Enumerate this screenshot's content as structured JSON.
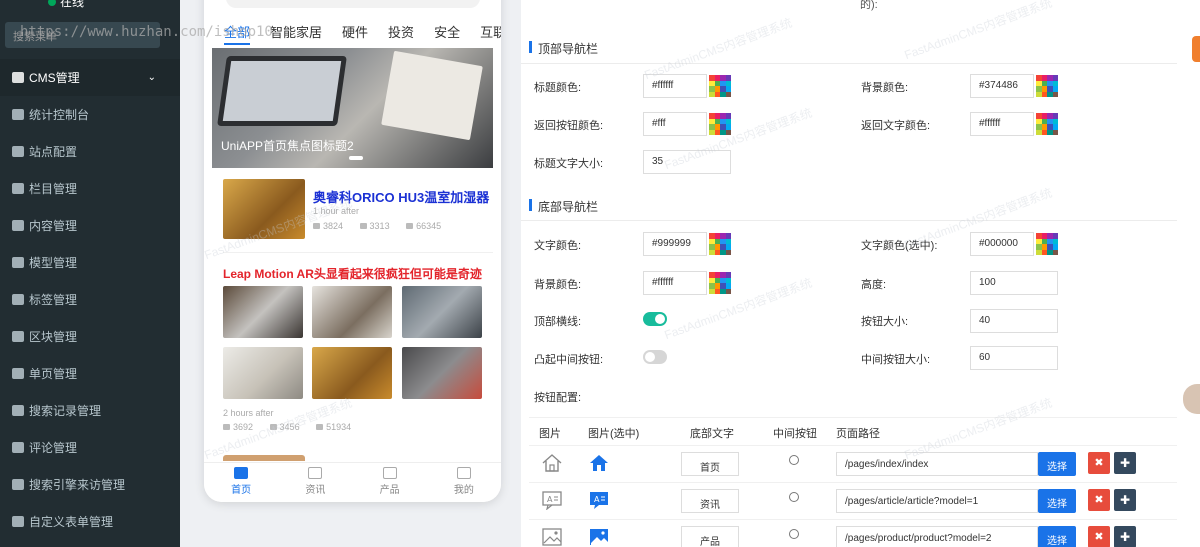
{
  "sidebar": {
    "status": "在线",
    "search_placeholder": "搜索菜单",
    "items": [
      {
        "label": "CMS管理",
        "icon": "file-icon",
        "active": true,
        "caret": "⌄"
      },
      {
        "label": "统计控制台",
        "icon": "bar-chart-icon"
      },
      {
        "label": "站点配置",
        "icon": "cogs-icon"
      },
      {
        "label": "栏目管理",
        "icon": "list-icon"
      },
      {
        "label": "内容管理",
        "icon": "file-text-icon"
      },
      {
        "label": "模型管理",
        "icon": "th-icon"
      },
      {
        "label": "标签管理",
        "icon": "tags-icon"
      },
      {
        "label": "区块管理",
        "icon": "th-large-icon"
      },
      {
        "label": "单页管理",
        "icon": "file-o-icon"
      },
      {
        "label": "搜索记录管理",
        "icon": "history-icon"
      },
      {
        "label": "评论管理",
        "icon": "comment-icon"
      },
      {
        "label": "搜索引擎来访管理",
        "icon": "search-icon"
      },
      {
        "label": "自定义表单管理",
        "icon": "table-icon"
      }
    ]
  },
  "watermark_url": "https://www.huzhan.com/ishop10",
  "watermark_text": "FastAdminCMS内容管理系统",
  "phone": {
    "tabs": [
      "全部",
      "智能家居",
      "硬件",
      "投资",
      "安全",
      "互联"
    ],
    "banner_caption": "UniAPP首页焦点图标题2",
    "article1": {
      "title": "奥睿科ORICO HU3温室加湿器",
      "time": "1 hour after",
      "likes": "3824",
      "comments": "3313",
      "views": "66345"
    },
    "article2": {
      "title": "Leap Motion AR头显看起来很疯狂但可能是奇迹",
      "time": "2 hours after",
      "likes": "3692",
      "comments": "3456",
      "views": "51934"
    },
    "tabbar": [
      {
        "label": "首页",
        "icon": "home-icon",
        "active": true
      },
      {
        "label": "资讯",
        "icon": "news-icon"
      },
      {
        "label": "产品",
        "icon": "image-icon"
      },
      {
        "label": "我的",
        "icon": "user-icon"
      }
    ]
  },
  "form": {
    "top_fragment": "的):",
    "top_nav_section": "顶部导航栏",
    "bottom_nav_section": "底部导航栏",
    "fields": {
      "title_color": {
        "label": "标题颜色:",
        "value": "#ffffff"
      },
      "bg_color": {
        "label": "背景颜色:",
        "value": "#374486"
      },
      "back_btn_color": {
        "label": "返回按钮颜色:",
        "value": "#fff"
      },
      "back_text_color": {
        "label": "返回文字颜色:",
        "value": "#ffffff"
      },
      "title_font_size": {
        "label": "标题文字大小:",
        "value": "35"
      },
      "text_color": {
        "label": "文字颜色:",
        "value": "#999999"
      },
      "text_color_selected": {
        "label": "文字颜色(选中):",
        "value": "#000000"
      },
      "bottom_bg_color": {
        "label": "背景颜色:",
        "value": "#ffffff"
      },
      "height": {
        "label": "高度:",
        "value": "100"
      },
      "top_border": {
        "label": "顶部横线:",
        "on": true
      },
      "button_size": {
        "label": "按钮大小:",
        "value": "40"
      },
      "raised_middle": {
        "label": "凸起中间按钮:",
        "on": false
      },
      "middle_button_size": {
        "label": "中间按钮大小:",
        "value": "60"
      },
      "button_config": {
        "label": "按钮配置:"
      }
    },
    "table": {
      "headers": [
        "图片",
        "图片(选中)",
        "底部文字",
        "中间按钮",
        "页面路径"
      ],
      "rows": [
        {
          "icon": "home-outline-icon",
          "icon_sel": "home-filled-icon",
          "text": "首页",
          "path": "/pages/index/index",
          "select_label": "选择",
          "delete": "✖",
          "move": "✚"
        },
        {
          "icon": "news-outline-icon",
          "icon_sel": "news-filled-icon",
          "text": "资讯",
          "path": "/pages/article/article?model=1",
          "select_label": "选择",
          "delete": "✖",
          "move": "✚"
        },
        {
          "icon": "image-outline-icon",
          "icon_sel": "image-filled-icon",
          "text": "产品",
          "path": "/pages/product/product?model=2",
          "select_label": "选择",
          "delete": "✖",
          "move": "✚"
        }
      ]
    }
  },
  "colors": {
    "accent": "#1a73e8",
    "sidebar_bg": "#222d32",
    "toggle_on": "#18bc9c",
    "danger": "#e74c3c",
    "dark": "#34495e"
  }
}
